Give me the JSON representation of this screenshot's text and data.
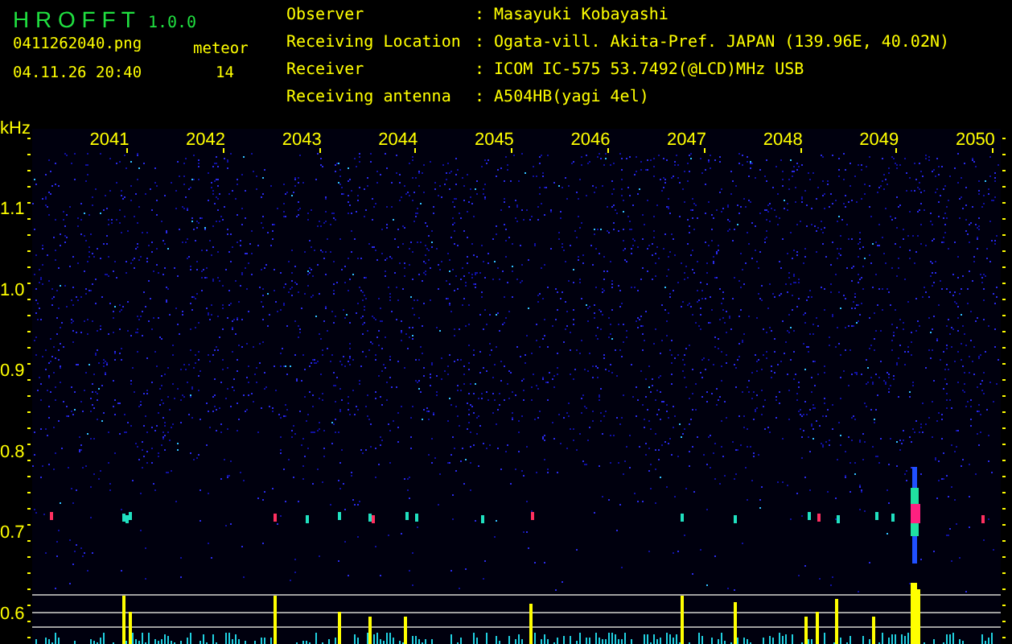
{
  "header": {
    "title": "H R O F F T",
    "version": "1.0.0",
    "filename": "0411262040.png",
    "datetime": "04.11.26 20:40",
    "meteor_label": "meteor",
    "meteor_count": "14"
  },
  "info": [
    {
      "label": "Observer",
      "value": ": Masayuki Kobayashi"
    },
    {
      "label": "Receiving Location",
      "value": ": Ogata-vill. Akita-Pref. JAPAN (139.96E, 40.02N)"
    },
    {
      "label": "Receiver",
      "value": ": ICOM IC-575 53.7492(@LCD)MHz USB"
    },
    {
      "label": "Receiving antenna",
      "value": ": A504HB(yagi 4el)"
    }
  ],
  "plot": {
    "unit": "kHz",
    "y_labels": [
      "1.1",
      "1.0",
      "0.9",
      "0.8",
      "0.7",
      "0.6"
    ],
    "x_labels": [
      "2041",
      "2042",
      "2043",
      "2044",
      "2045",
      "2046",
      "2047",
      "2048",
      "2049",
      "2050"
    ]
  }
}
